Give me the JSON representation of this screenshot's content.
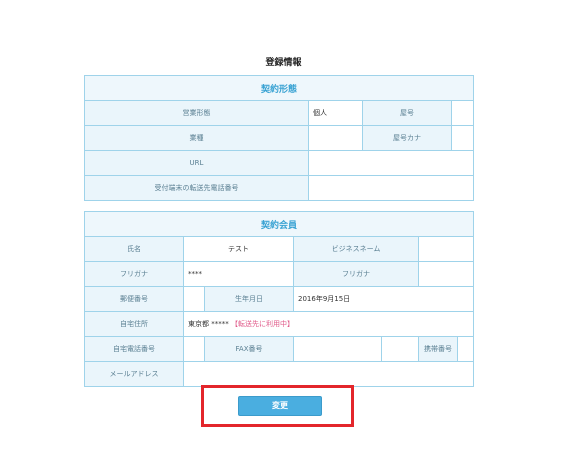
{
  "page": {
    "title": "登録情報"
  },
  "contract_form": {
    "heading": "契約形態",
    "rows": {
      "business_type_label": "営業形態",
      "business_type_value": "個人",
      "trade_name_label": "屋号",
      "trade_name_value": "",
      "industry_label": "業種",
      "industry_value": "",
      "trade_name_kana_label": "屋号カナ",
      "trade_name_kana_value": "",
      "url_label": "URL",
      "url_value": "",
      "forward_phone_label": "受付端末の転送先電話番号",
      "forward_phone_value": ""
    }
  },
  "member": {
    "heading": "契約会員",
    "rows": {
      "name_label": "氏名",
      "name_value": "テスト",
      "business_name_label": "ビジネスネーム",
      "business_name_value": "",
      "furigana_label": "フリガナ",
      "furigana_value": "****",
      "business_furigana_label": "フリガナ",
      "business_furigana_value": "",
      "postal_label": "郵便番号",
      "postal_value": "",
      "birthday_label": "生年月日",
      "birthday_value": "2016年9月15日",
      "address_label": "自宅住所",
      "address_value": "東京都 *****",
      "address_note": "【転送先に利用中】",
      "home_phone_label": "自宅電話番号",
      "home_phone_value": "",
      "fax_label": "FAX番号",
      "fax_value": "",
      "mobile_label": "携帯番号",
      "mobile_value": "",
      "email_label": "メールアドレス",
      "email_value": ""
    }
  },
  "actions": {
    "change_label": "変更"
  },
  "colors": {
    "accent": "#4aaee0",
    "header_text": "#3aa3d3",
    "highlight": "#e3262b",
    "warning": "#e05a8a"
  }
}
